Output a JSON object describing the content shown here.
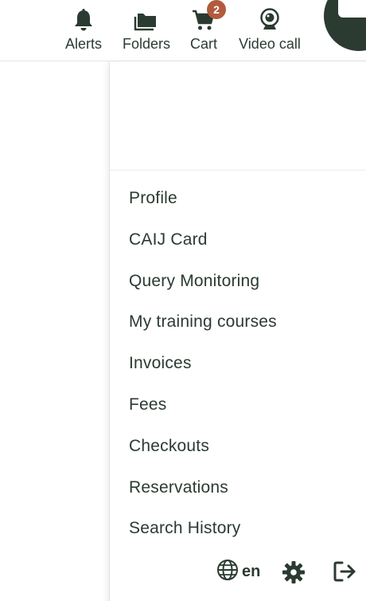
{
  "header": {
    "nav": [
      {
        "label": "Alerts",
        "icon": "bell-icon"
      },
      {
        "label": "Folders",
        "icon": "folder-icon"
      },
      {
        "label": "Cart",
        "icon": "cart-icon",
        "badge": "2"
      },
      {
        "label": "Video call",
        "icon": "webcam-icon"
      }
    ],
    "avatar_color": "#2b3b31",
    "badge_color": "#b35a3c"
  },
  "menu": {
    "items": [
      {
        "label": "Profile"
      },
      {
        "label": "CAIJ Card"
      },
      {
        "label": "Query Monitoring"
      },
      {
        "label": "My training courses"
      },
      {
        "label": "Invoices"
      },
      {
        "label": "Fees"
      },
      {
        "label": "Checkouts"
      },
      {
        "label": "Reservations"
      },
      {
        "label": "Search History"
      }
    ]
  },
  "footer": {
    "language": "en",
    "language_icon": "globe-icon",
    "settings_icon": "gear-icon",
    "logout_icon": "logout-icon"
  },
  "colors": {
    "text": "#2b3b31",
    "accent": "#2b3b31"
  }
}
